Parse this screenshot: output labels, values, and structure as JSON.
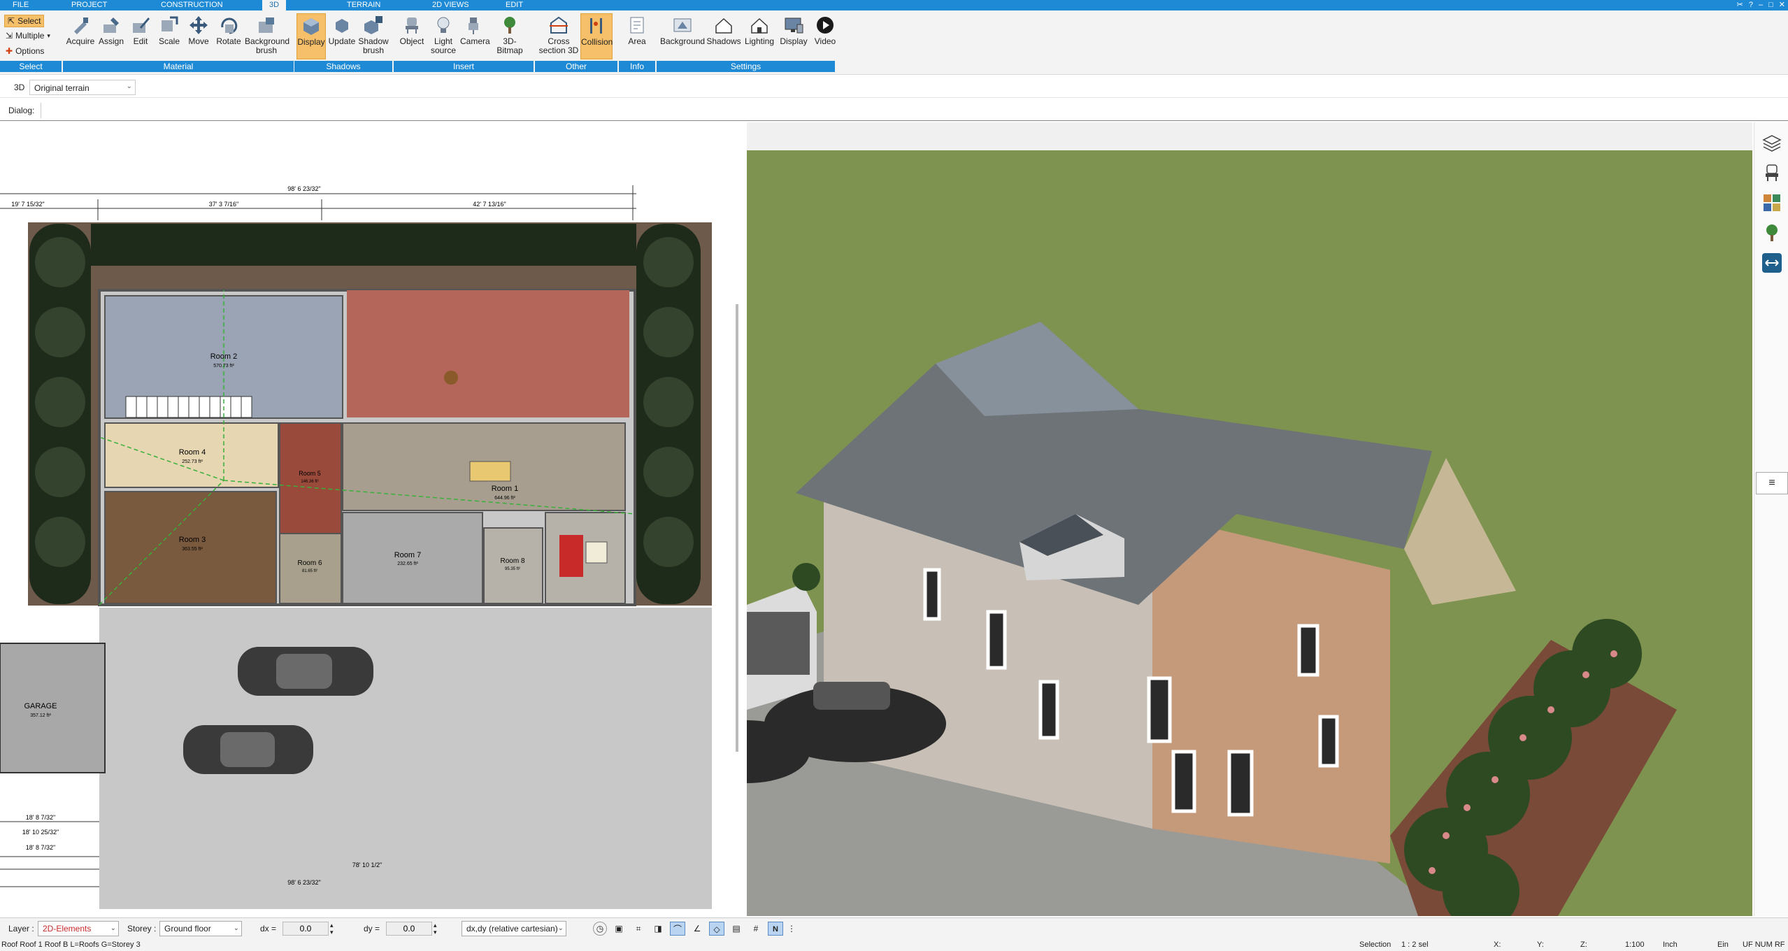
{
  "menu": {
    "tabs": [
      "FILE",
      "PROJECT",
      "CONSTRUCTION",
      "3D",
      "TERRAIN",
      "2D VIEWS",
      "EDIT"
    ],
    "active": "3D"
  },
  "ribbon": {
    "select_group": {
      "select": "Select",
      "multiple": "Multiple",
      "options": "Options",
      "label": "Select"
    },
    "material": {
      "buttons": [
        "Acquire",
        "Assign",
        "Edit",
        "Scale",
        "Move",
        "Rotate",
        "Background brush"
      ],
      "label": "Material"
    },
    "shadows": {
      "buttons": [
        "Display",
        "Update",
        "Shadow brush"
      ],
      "label": "Shadows"
    },
    "insert": {
      "buttons": [
        "Object",
        "Light source",
        "Camera",
        "3D-Bitmap"
      ],
      "label": "Insert"
    },
    "other": {
      "buttons": [
        "Cross section 3D",
        "Collision"
      ],
      "label": "Other"
    },
    "info": {
      "buttons": [
        "Area"
      ],
      "label": "Info"
    },
    "settings": {
      "buttons": [
        "Background",
        "Shadows",
        "Lighting",
        "Display",
        "Video"
      ],
      "label": "Settings"
    }
  },
  "toolbar2": {
    "mode": "3D",
    "terrain": "Original terrain"
  },
  "toolbar3": {
    "dialog_label": "Dialog:"
  },
  "plan": {
    "rooms": [
      {
        "name": "Room 2",
        "area": "570.73 ft²"
      },
      {
        "name": "Room 4",
        "area": "252.73 ft²"
      },
      {
        "name": "Room 3",
        "area": "363.55 ft²"
      },
      {
        "name": "Room 5",
        "area": "146.36 ft²"
      },
      {
        "name": "Room 1",
        "area": "644.96 ft²"
      },
      {
        "name": "Room 6",
        "area": "81.65 ft²"
      },
      {
        "name": "Room 7",
        "area": "232.65 ft²"
      },
      {
        "name": "Room 8",
        "area": "95.35 ft²"
      },
      {
        "name": "GARAGE",
        "area": "357.12 ft²"
      }
    ],
    "dims": {
      "top_total": "98' 6 23/32\"",
      "top_left": "37' 3 7/16\"",
      "top_right": "42' 7 13/16\"",
      "top_small": "19' 7 15/32\"",
      "bottom_total": "98' 6 23/32\"",
      "bottom_mid": "78' 10 1/2\"",
      "bottom_a": "18' 8 7/32\"",
      "bottom_b": "18' 10 25/32\"",
      "bottom_c": "18' 8 7/32\""
    }
  },
  "status": {
    "layer_label": "Layer :",
    "layer_value": "2D-Elements",
    "storey_label": "Storey :",
    "storey_value": "Ground floor",
    "dx_label": "dx =",
    "dx_value": "0.0",
    "dy_label": "dy =",
    "dy_value": "0.0",
    "coord_mode": "dx,dy (relative cartesian)"
  },
  "footer": {
    "left": "Roof Roof 1 Roof B L=Roofs G=Storey 3",
    "selection": "Selection",
    "sel_count": "1 : 2 sel",
    "x": "X:",
    "y": "Y:",
    "z": "Z:",
    "scale": "1:100",
    "unit": "Inch",
    "ein": "Ein",
    "flags": "UF NUM RF"
  },
  "colors": {
    "accent": "#1e8ad6",
    "grass": "#7f9350",
    "roof": "#6e7378",
    "hatch": "#f6c06a"
  }
}
